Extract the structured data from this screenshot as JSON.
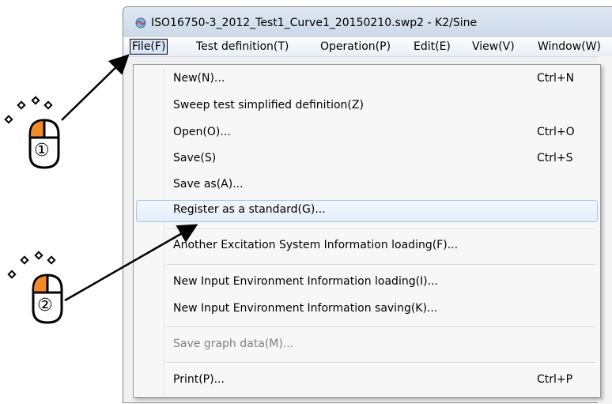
{
  "window": {
    "title": "ISO16750-3_2012_Test1_Curve1_20150210.swp2 - K2/Sine"
  },
  "menubar": {
    "items": [
      {
        "label": "File(F)",
        "active": true
      },
      {
        "label": "Test definition(T)"
      },
      {
        "label": "Operation(P)"
      },
      {
        "label": "Edit(E)"
      },
      {
        "label": "View(V)"
      },
      {
        "label": "Window(W)"
      }
    ]
  },
  "file_menu": {
    "items": [
      {
        "label": "New(N)...",
        "shortcut": "Ctrl+N"
      },
      {
        "label": "Sweep test simplified definition(Z)",
        "shortcut": ""
      },
      {
        "label": "Open(O)...",
        "shortcut": "Ctrl+O"
      },
      {
        "label": "Save(S)",
        "shortcut": "Ctrl+S"
      },
      {
        "label": "Save as(A)...",
        "shortcut": ""
      },
      {
        "label": "Register as a standard(G)...",
        "shortcut": "",
        "highlighted": true
      },
      {
        "label": "Another Excitation System Information loading(F)...",
        "shortcut": ""
      },
      {
        "label": "New Input Environment Information loading(I)...",
        "shortcut": ""
      },
      {
        "label": "New Input Environment Information saving(K)...",
        "shortcut": ""
      },
      {
        "label": "Save graph data(M)...",
        "shortcut": "",
        "disabled": true
      },
      {
        "label": "Print(P)...",
        "shortcut": "Ctrl+P"
      }
    ]
  },
  "annotations": {
    "step1": "①",
    "step2": "②",
    "accent_color": "#f28c28"
  }
}
